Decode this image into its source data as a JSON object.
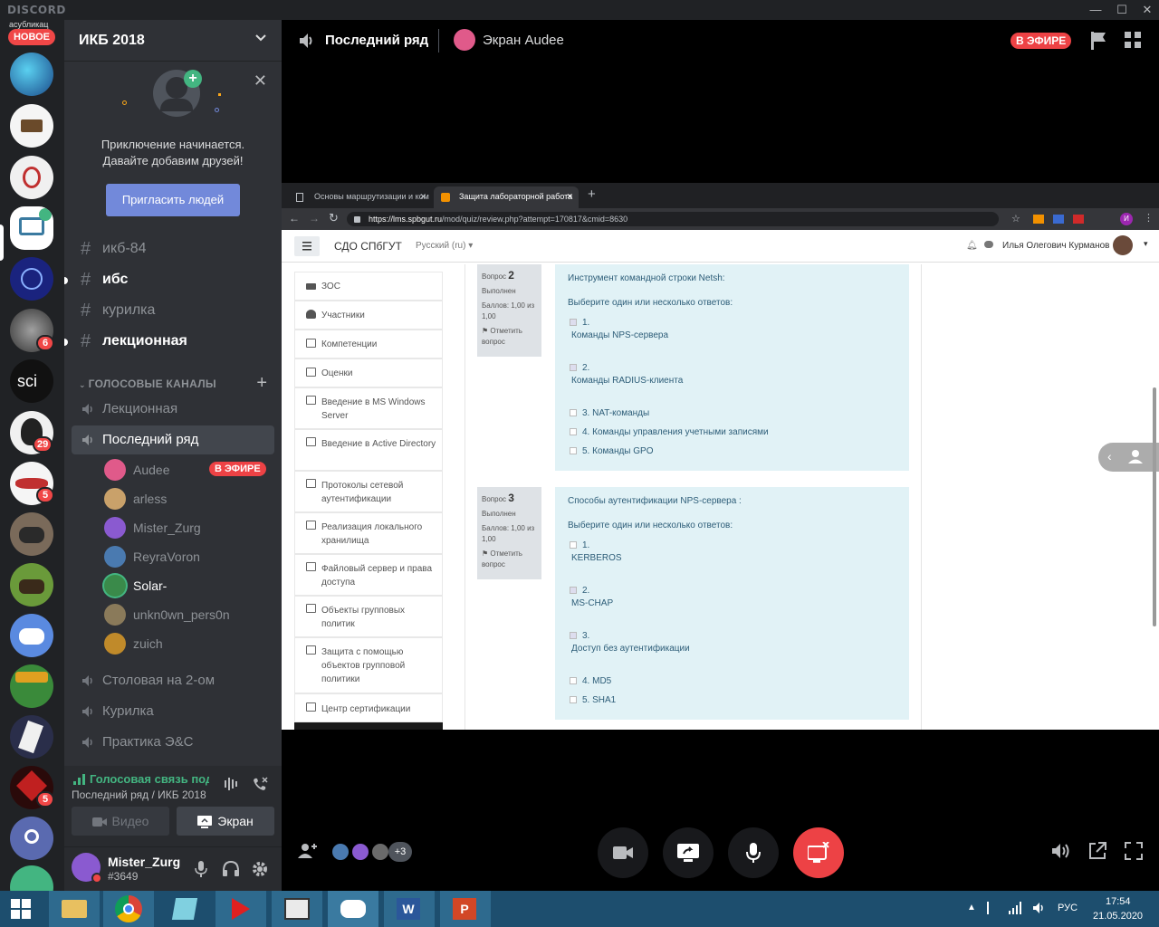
{
  "titlebar": {
    "brand": "DISCORD",
    "minimize": "—",
    "maximize": "☐",
    "close": "✕"
  },
  "rail": {
    "sub_label": "асубликац",
    "new_badge": "НОВОЕ",
    "badges": {
      "srv6": "6",
      "srv8": "29",
      "srv9": "5",
      "srv15": "5"
    }
  },
  "guild": {
    "name": "ИКБ 2018",
    "chevron": "⌄"
  },
  "invite": {
    "line1": "Приключение начинается.",
    "line2": "Давайте добавим друзей!",
    "button": "Пригласить людей",
    "close": "✕"
  },
  "text_channels": [
    {
      "name": "икб-84",
      "unread": false
    },
    {
      "name": "ибс",
      "unread": true
    },
    {
      "name": "курилка",
      "unread": false
    },
    {
      "name": "лекционная",
      "unread": true
    }
  ],
  "voice_category": {
    "label": "ГОЛОСОВЫЕ КАНАЛЫ",
    "add": "+"
  },
  "voice_channels": {
    "lecture": "Лекционная",
    "last_row": "Последний ряд",
    "dining": "Столовая на 2-ом",
    "smoking": "Курилка",
    "practice": "Практика Э&C"
  },
  "voice_users": [
    {
      "name": "Audee",
      "live": "В ЭФИРЕ",
      "color": "#e05a8a"
    },
    {
      "name": "arless",
      "color": "#c9a16a"
    },
    {
      "name": "Mister_Zurg",
      "color": "#8a5ad0"
    },
    {
      "name": "ReyraVoron",
      "color": "#4a7ab0"
    },
    {
      "name": "Solar-",
      "color": "#3a8a4a"
    },
    {
      "name": "unkn0wn_pers0n",
      "color": "#8a7a5a"
    },
    {
      "name": "zuich",
      "color": "#c08a2a"
    }
  ],
  "voice_panel": {
    "status": "Голосовая связь подключена",
    "subtitle": "Последний ряд / ИКБ 2018",
    "video": "Видео",
    "screen": "Экран"
  },
  "user_panel": {
    "name": "Mister_Zurg",
    "tag": "#3649"
  },
  "main_header": {
    "channel": "Последний ряд",
    "screen_label": "Экран Audee",
    "live": "В ЭФИРЕ"
  },
  "browser": {
    "tabs": [
      "Основы маршрутизации и ком",
      "Защита лабораторной работа"
    ],
    "new_tab": "+",
    "url_host": "https://lms.spbgut.ru",
    "url_path": "/mod/quiz/review.php?attempt=170817&cmid=8630",
    "avatar_initial": "И"
  },
  "lms": {
    "site": "СДО СПбГУТ",
    "language": "Русский (ru)",
    "user": "Илья Олегович Курманов",
    "nav": [
      "ЗОС",
      "Участники",
      "Компетенции",
      "Оценки",
      "Введение в MS Windows Server",
      "Введение в Active Directory",
      "Протоколы сетевой аутентификации",
      "Реализация локального хранилища",
      "Файловый сервер и права доступа",
      "Объекты групповых политик",
      "Защита с помощью объектов групповой политики",
      "Центр сертификации"
    ],
    "questions": [
      {
        "label": "Вопрос",
        "number": "2",
        "status": "Выполнен",
        "score": "Баллов: 1,00 из 1,00",
        "flag": "Отметить вопрос",
        "text": "Инструмент командной строки Netsh:",
        "prompt": "Выберите один или несколько ответов:",
        "options": [
          {
            "num": "1.",
            "text": "Команды NPS-сервера",
            "checked": true
          },
          {
            "num": "2.",
            "text": "Команды RADIUS-клиента",
            "checked": true
          },
          {
            "num": "",
            "text": "3. NAT-команды",
            "checked": false
          },
          {
            "num": "",
            "text": "4. Команды управления учетными записями",
            "checked": false
          },
          {
            "num": "",
            "text": "5. Команды GPO",
            "checked": false
          }
        ]
      },
      {
        "label": "Вопрос",
        "number": "3",
        "status": "Выполнен",
        "score": "Баллов: 1,00 из 1,00",
        "flag": "Отметить вопрос",
        "text": "Способы аутентификации NPS-сервера :",
        "prompt": "Выберите один или несколько ответов:",
        "options": [
          {
            "num": "1.",
            "text": "KERBEROS",
            "checked": false
          },
          {
            "num": "2.",
            "text": "MS-CHAP",
            "checked": true
          },
          {
            "num": "3.",
            "text": "Доступ без аутентификации",
            "checked": true
          },
          {
            "num": "",
            "text": "4. MD5",
            "checked": false
          },
          {
            "num": "",
            "text": "5. SHA1",
            "checked": false
          }
        ]
      }
    ]
  },
  "participants": {
    "more": "+3"
  },
  "taskbar": {
    "lang": "РУС",
    "time": "17:54",
    "date": "21.05.2020"
  },
  "colors": {
    "blurple": "#7289da",
    "live": "#ed4245",
    "green": "#43b581",
    "rail": "#202225",
    "panel": "#2f3136"
  }
}
